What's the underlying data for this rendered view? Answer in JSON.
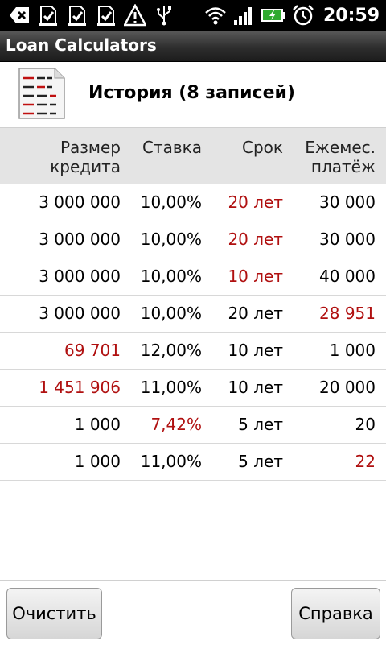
{
  "status_bar": {
    "time": "20:59",
    "icons": [
      "usb-debug-icon",
      "download-done-icon",
      "download-done-icon",
      "download-done-icon",
      "warning-icon",
      "usb-icon",
      "wifi-icon",
      "signal-icon",
      "battery-charging-icon",
      "alarm-icon"
    ]
  },
  "app": {
    "title": "Loan Calculators"
  },
  "header": {
    "title": "История (8 записей)"
  },
  "table": {
    "columns": [
      "Размер\nкредита",
      "Ставка",
      "Срок",
      "Ежемес.\nплатёж"
    ],
    "rows": [
      [
        "3 000 000",
        "10,00%",
        "20 лет",
        "30 000"
      ],
      [
        "3 000 000",
        "10,00%",
        "20 лет",
        "30 000"
      ],
      [
        "3 000 000",
        "10,00%",
        "10 лет",
        "40 000"
      ],
      [
        "3 000 000",
        "10,00%",
        "20 лет",
        "28 951"
      ],
      [
        "69 701",
        "12,00%",
        "10 лет",
        "1 000"
      ],
      [
        "1 451 906",
        "11,00%",
        "10 лет",
        "20 000"
      ],
      [
        "1 000",
        "7,42%",
        "5 лет",
        "20"
      ],
      [
        "1 000",
        "11,00%",
        "5 лет",
        "22"
      ]
    ],
    "highlighted": [
      [
        0,
        2
      ],
      [
        1,
        2
      ],
      [
        2,
        2
      ],
      [
        3,
        3
      ],
      [
        4,
        0
      ],
      [
        5,
        0
      ],
      [
        6,
        1
      ],
      [
        7,
        3
      ]
    ],
    "highlight_color": "#b01010"
  },
  "buttons": {
    "clear": "Очистить",
    "help": "Справка"
  }
}
